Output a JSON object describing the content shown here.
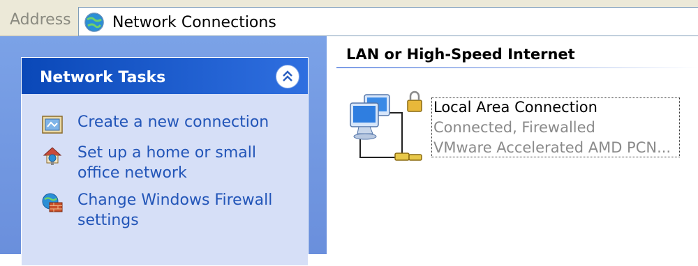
{
  "address_bar": {
    "label": "Address",
    "value": "Network Connections",
    "icon": "network-globe-icon"
  },
  "task_pane": {
    "title": "Network Tasks",
    "collapse_icon": "double-chevron-up-icon",
    "items": [
      {
        "label": "Create a new connection",
        "icon": "new-connection-icon"
      },
      {
        "label": "Set up a home or small office network",
        "icon": "home-network-icon"
      },
      {
        "label": "Change Windows Firewall settings",
        "icon": "firewall-icon"
      }
    ]
  },
  "content": {
    "group_title": "LAN or High-Speed Internet",
    "connection": {
      "name": "Local Area Connection",
      "status": "Connected, Firewalled",
      "device": "VMware Accelerated AMD PCN...",
      "icon": "lan-connection-locked-icon"
    }
  }
}
